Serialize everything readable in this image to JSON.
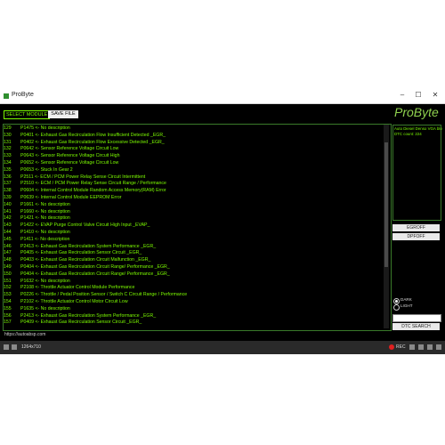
{
  "window": {
    "title": "ProByte"
  },
  "toolbar": {
    "select_module": "SELECT MODULE",
    "save_file": "SAVE FILE"
  },
  "brand": "ProByte",
  "info": {
    "lines": [
      "Auto Diesel Denso  VGA blo",
      "DTC count: 224"
    ]
  },
  "side_buttons": {
    "egr_off": "EGROFF",
    "dpf_off": "DPFOFF",
    "dtc_search": "DTC SEARCH"
  },
  "theme": {
    "dark": "DARK",
    "light": "LIGHT",
    "selected": "dark"
  },
  "colors": {
    "accent": "#7CFC00",
    "background": "#000000",
    "brand": "#8fd14f"
  },
  "dtc_list": [
    {
      "num": "129",
      "text": "P1475 <- No description"
    },
    {
      "num": "130",
      "text": "P0401 <- Exhaust Gas Recirculation Flow Insufficient Detected _EGR_"
    },
    {
      "num": "131",
      "text": "P0402 <- Exhaust Gas Recirculation Flow Excessive Detected _EGR_"
    },
    {
      "num": "132",
      "text": "P0642 <- Sensor Reference Voltage Circuit Low"
    },
    {
      "num": "133",
      "text": "P0643 <- Sensor Reference Voltage Circuit High"
    },
    {
      "num": "134",
      "text": "P0652 <- Sensor Reference Voltage Circuit Low"
    },
    {
      "num": "135",
      "text": "P0653 <- Stuck In Gear 2"
    },
    {
      "num": "136",
      "text": "P2511 <- ECM / PCM Power Relay Sense Circuit Intermittent"
    },
    {
      "num": "137",
      "text": "P2510 <- ECM / PCM Power Relay Sense Circuit Range / Performance"
    },
    {
      "num": "138",
      "text": "P0604 <- Internal Control Module Random Access Memory(RAM) Error"
    },
    {
      "num": "139",
      "text": "P0639 <- Internal Control Module EEPROM Error"
    },
    {
      "num": "140",
      "text": "P1661 <- No description"
    },
    {
      "num": "141",
      "text": "P1660 <- No description"
    },
    {
      "num": "142",
      "text": "P1421 <- No description"
    },
    {
      "num": "143",
      "text": "P1422 <- EVAP Purge Control Valve Circuit High Input _EVAP_"
    },
    {
      "num": "144",
      "text": "P1410 <- No description"
    },
    {
      "num": "145",
      "text": "P1411 <- No description"
    },
    {
      "num": "146",
      "text": "P2413 <- Exhaust Gas Recirculation System Performance _EGR_"
    },
    {
      "num": "147",
      "text": "P0405 <- Exhaust Gas Recirculation Sensor Circuit _EGR_"
    },
    {
      "num": "148",
      "text": "P0403 <- Exhaust Gas Recirculation Circuit Malfunction _EGR_"
    },
    {
      "num": "149",
      "text": "P0404 <- Exhaust Gas Recirculation Circuit Range/ Performance _EGR_"
    },
    {
      "num": "150",
      "text": "P0404 <- Exhaust Gas Recirculation Circuit Range/ Performance _EGR_"
    },
    {
      "num": "151",
      "text": "P1632 <- No description"
    },
    {
      "num": "152",
      "text": "P2108 <- Throttle Actuator Control Module Performance"
    },
    {
      "num": "153",
      "text": "P0226 <- Throttle / Pedal Position Sensor / Switch C Circuit Range / Performance"
    },
    {
      "num": "154",
      "text": "P2102 <- Throttle Actuator Control Motor Circuit Low"
    },
    {
      "num": "155",
      "text": "P1635 <- No description"
    },
    {
      "num": "156",
      "text": "P2413 <- Exhaust Gas Recirculation System Performance _EGR_"
    },
    {
      "num": "157",
      "text": "P0409 <- Exhaust Gas Recirculation Sensor Circuit _EGR_"
    }
  ],
  "footer": {
    "url": "https://autoabsp.com"
  },
  "statusbar": {
    "resolution": "1264x710",
    "rec": "REC"
  }
}
